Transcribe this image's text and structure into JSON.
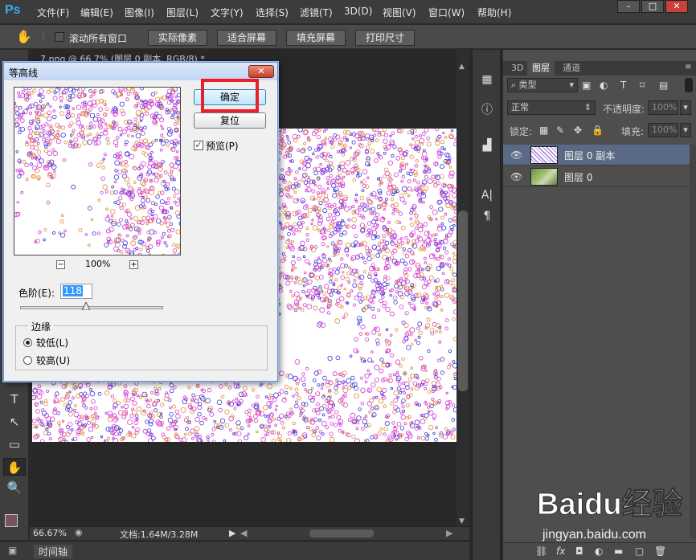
{
  "app": {
    "logo": "Ps",
    "menus": [
      "文件(F)",
      "编辑(E)",
      "图像(I)",
      "图层(L)",
      "文字(Y)",
      "选择(S)",
      "滤镜(T)",
      "3D(D)",
      "视图(V)",
      "窗口(W)",
      "帮助(H)"
    ],
    "window_controls": [
      "–",
      "□",
      "✕"
    ]
  },
  "options_bar": {
    "scroll_all_label": "滚动所有窗口",
    "buttons": [
      "实际像素",
      "适合屏幕",
      "填充屏幕",
      "打印尺寸"
    ]
  },
  "document": {
    "tab_title": "7.png @ 66.7% (图层 0 副本, RGB/8) *",
    "status_zoom": "66.67%",
    "status_doc": "文档:1.64M/3.28M",
    "timeline_label": "时间轴"
  },
  "layers_panel": {
    "tabs": [
      "3D",
      "图层",
      "通道"
    ],
    "active_tab": "图层",
    "filter_kind": "类型",
    "blend_mode": "正常",
    "opacity_label": "不透明度:",
    "opacity_value": "100%",
    "lock_label": "锁定:",
    "fill_label": "填充:",
    "fill_value": "100%",
    "layers": [
      {
        "name": "图层 0 副本",
        "selected": true
      },
      {
        "name": "图层 0",
        "selected": false
      }
    ],
    "bottom_icons": [
      "link-icon",
      "fx-icon",
      "mask-icon",
      "adjustment-icon",
      "group-icon",
      "new-layer-icon",
      "trash-icon"
    ]
  },
  "dialog": {
    "title": "等高线",
    "close": "✕",
    "ok_label": "确定",
    "reset_label": "复位",
    "preview_label": "预览(P)",
    "preview_checked": true,
    "zoom_minus": "−",
    "zoom_value": "100%",
    "zoom_plus": "+",
    "level_label": "色阶(E):",
    "level_value": "118",
    "level_max": 255,
    "edge_group_title": "边缘",
    "edge_options": [
      {
        "label": "较低(L)",
        "checked": true
      },
      {
        "label": "较高(U)",
        "checked": false
      }
    ]
  },
  "watermark": {
    "brand": "Baidu经验",
    "url": "jingyan.baidu.com"
  },
  "colors": {
    "accent_highlight": "#e8202a",
    "layer_selected": "#5a6a86",
    "contour_magenta": "#d23cd2",
    "contour_blue": "#3a3ad8",
    "contour_orange": "#e08a3a"
  }
}
